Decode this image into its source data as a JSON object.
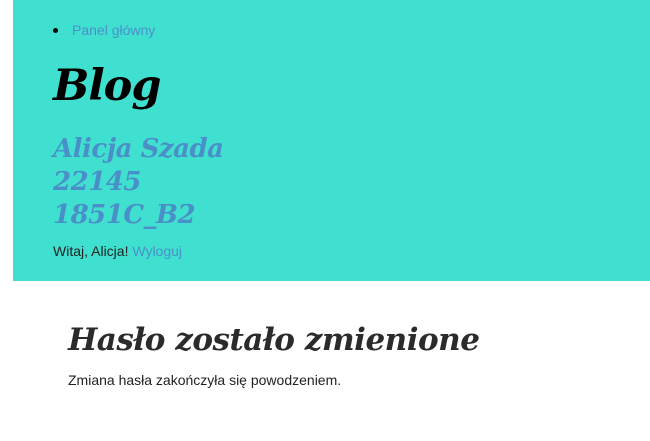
{
  "nav": {
    "items": [
      {
        "label": "Panel główny"
      }
    ]
  },
  "header": {
    "blog_title": "Blog",
    "user": {
      "name": "Alicja Szada",
      "id": "22145",
      "group": "1851C_B2"
    },
    "welcome_text": "Witaj, Alicja!",
    "logout_label": "Wyloguj"
  },
  "main": {
    "title": "Hasło zostało zmienione",
    "message": "Zmiana hasła zakończyła się powodzeniem."
  },
  "colors": {
    "header_background": "#40e0d0",
    "link": "#4a90c8",
    "heading": "#2b2b2b"
  }
}
